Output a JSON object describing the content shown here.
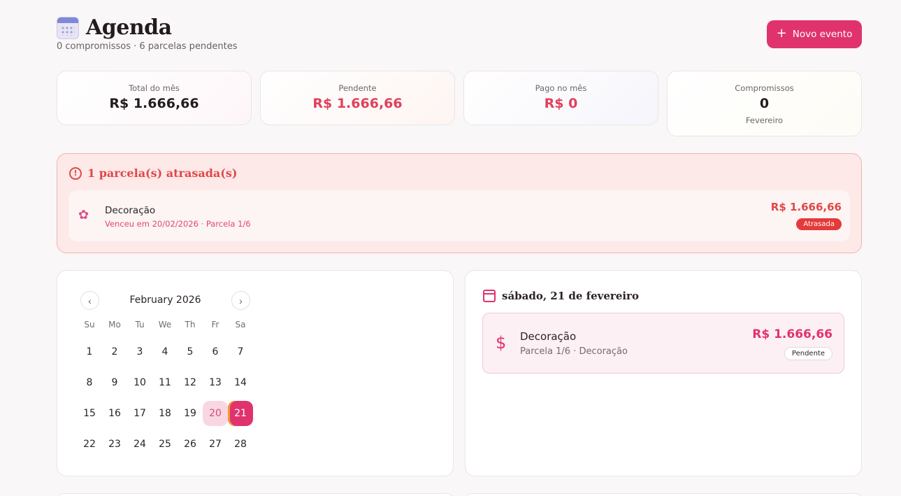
{
  "header": {
    "title": "Agenda",
    "subtitle": "0 compromissos · 6 parcelas pendentes",
    "new_event_label": "Novo evento"
  },
  "stats": [
    {
      "label": "Total do mês",
      "value": "R$ 1.666,66"
    },
    {
      "label": "Pendente",
      "value": "R$ 1.666,66"
    },
    {
      "label": "Pago no mês",
      "value": "R$ 0"
    },
    {
      "label": "Compromissos",
      "value": "0",
      "sub": "Fevereiro"
    }
  ],
  "overdue": {
    "title": "1 parcela(s) atrasada(s)",
    "items": [
      {
        "name": "Decoração",
        "meta": "Venceu em 20/02/2026 · Parcela 1/6",
        "amount": "R$ 1.666,66",
        "status": "Atrasada"
      }
    ]
  },
  "calendar": {
    "month": "February 2026",
    "weekdays": [
      "Su",
      "Mo",
      "Tu",
      "We",
      "Th",
      "Fr",
      "Sa"
    ],
    "days": [
      "1",
      "2",
      "3",
      "4",
      "5",
      "6",
      "7",
      "8",
      "9",
      "10",
      "11",
      "12",
      "13",
      "14",
      "15",
      "16",
      "17",
      "18",
      "19",
      "20",
      "21",
      "22",
      "23",
      "24",
      "25",
      "26",
      "27",
      "28"
    ],
    "today": "20",
    "selected": "21"
  },
  "day_detail": {
    "title": "sábado, 21 de fevereiro",
    "events": [
      {
        "name": "Decoração",
        "meta": "Parcela 1/6 · Decoração",
        "amount": "R$ 1.666,66",
        "status": "Pendente"
      }
    ]
  },
  "colors": {
    "accent": "#e0336d",
    "danger": "#e04848",
    "background": "#f9f7f8"
  },
  "icons": {
    "title": "calendar-emoji-icon",
    "add": "plus-icon",
    "alert": "alert-circle-icon",
    "overdue_item": "bouquet-icon",
    "prev": "chevron-left-icon",
    "next": "chevron-right-icon",
    "day": "calendar-icon",
    "event": "dollar-icon"
  }
}
